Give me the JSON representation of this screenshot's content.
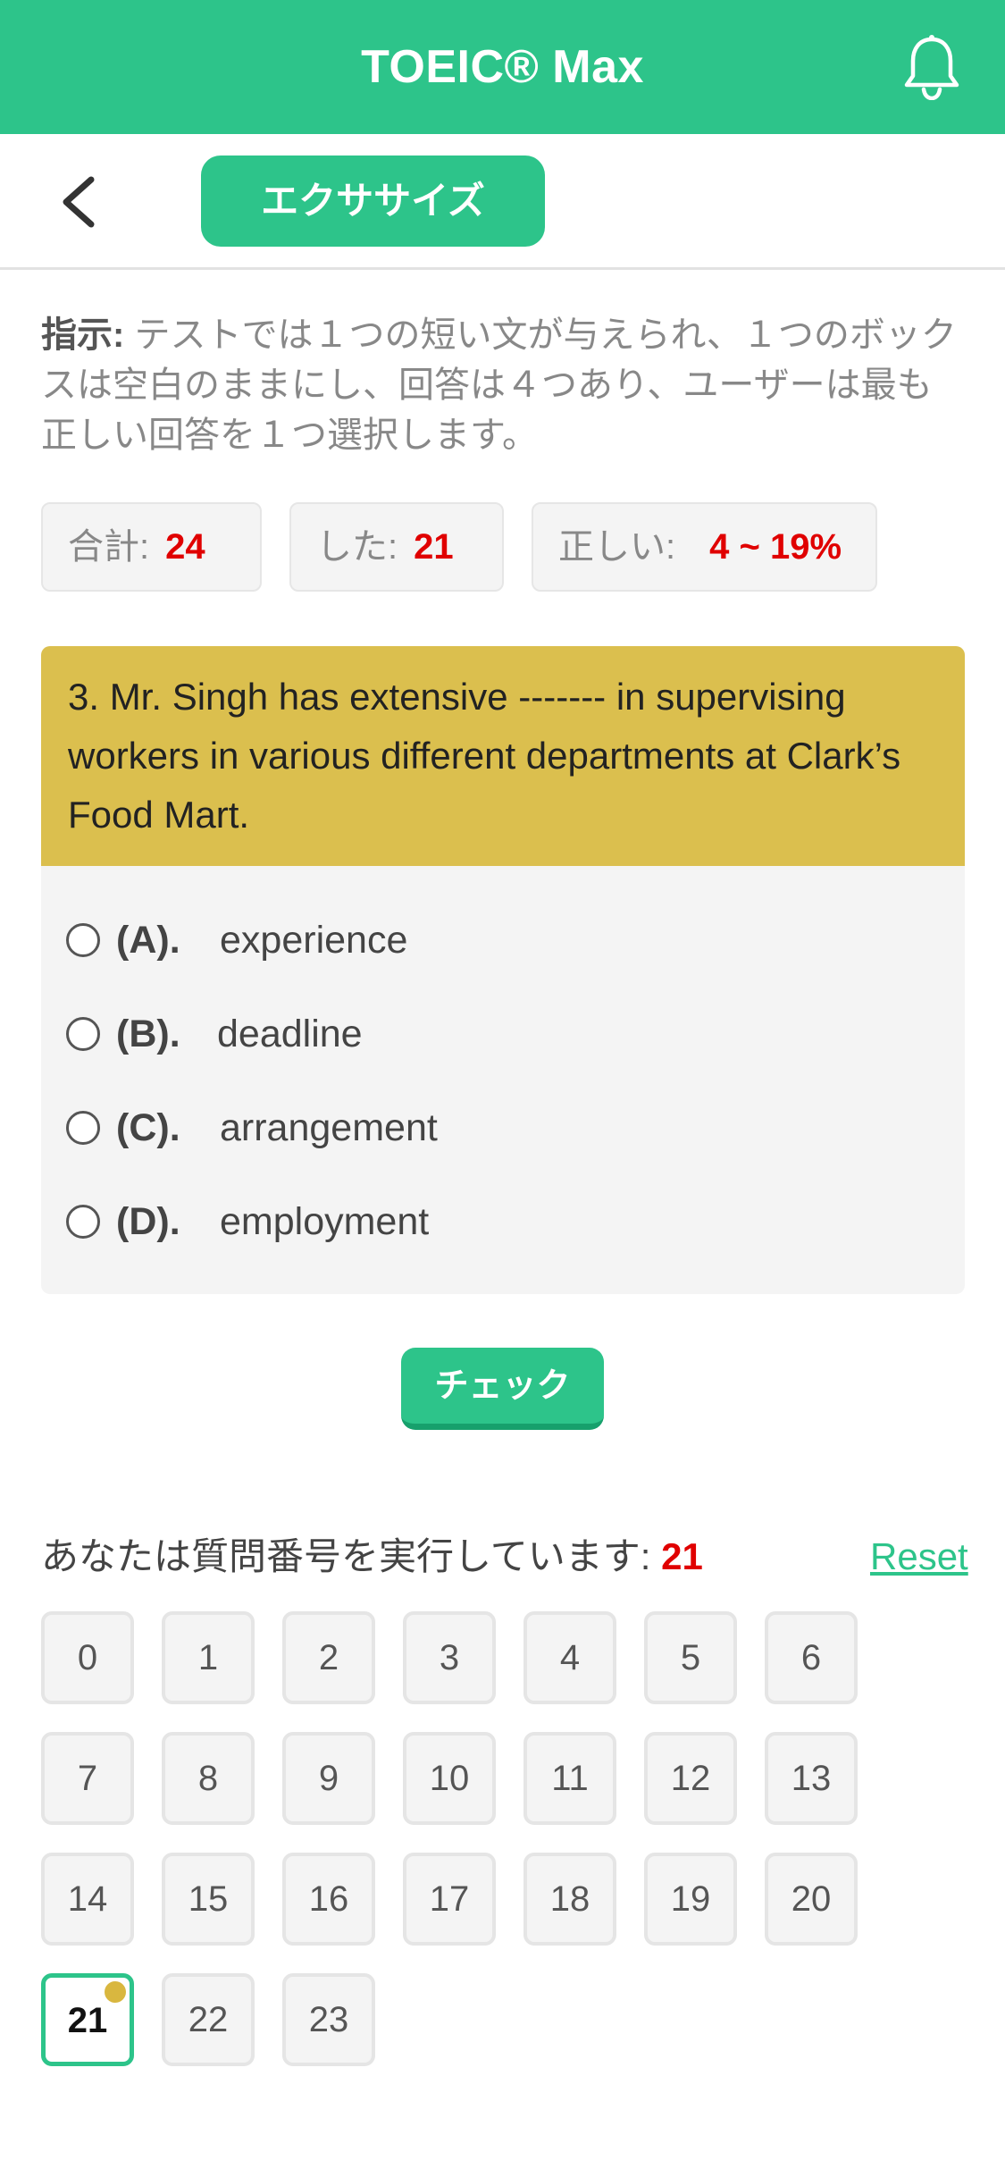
{
  "header": {
    "title": "TOEIC® Max",
    "bell_icon": "bell-icon"
  },
  "nav": {
    "back_icon": "back-arrow-icon",
    "tab_label": "エクササイズ"
  },
  "instructions": {
    "label": "指示:",
    "text": " テストでは１つの短い文が与えられ、１つのボックスは空白のままにし、回答は４つあり、ユーザーは最も正しい回答を１つ選択します。"
  },
  "stats": {
    "total_label": "合計:",
    "total_value": "24",
    "done_label": "した:",
    "done_value": "21",
    "correct_label": "正しい:",
    "correct_value": "4 ~ 19%"
  },
  "question": {
    "text": "3. Mr. Singh has extensive ------- in supervising workers in various different departments at Clark’s Food Mart.",
    "options": [
      {
        "letter": "(A).",
        "text": "experience"
      },
      {
        "letter": "(B).",
        "text": "deadline"
      },
      {
        "letter": "(C).",
        "text": "arrangement"
      },
      {
        "letter": "(D).",
        "text": "employment"
      }
    ]
  },
  "check_button": "チェック",
  "progress": {
    "label": "あなたは質問番号を実行しています:",
    "current": "21",
    "reset_label": "Reset",
    "numbers": [
      "0",
      "1",
      "2",
      "3",
      "4",
      "5",
      "6",
      "7",
      "8",
      "9",
      "10",
      "11",
      "12",
      "13",
      "14",
      "15",
      "16",
      "17",
      "18",
      "19",
      "20",
      "21",
      "22",
      "23"
    ]
  },
  "colors": {
    "brand": "#2dc48a",
    "question_bg": "#dbbf4e",
    "accent_red": "#e00000"
  }
}
